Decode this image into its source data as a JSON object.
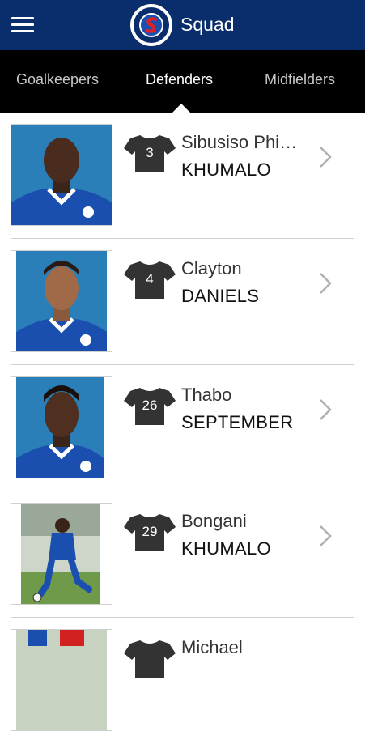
{
  "header": {
    "title": "Squad",
    "logo_alt": "SUPERSPORT UNITED FC"
  },
  "tabs": [
    {
      "label": "Goalkeepers",
      "active": false
    },
    {
      "label": "Defenders",
      "active": true
    },
    {
      "label": "Midfielders",
      "active": false
    }
  ],
  "players": [
    {
      "first": "Sibusiso Phi…",
      "last": "KHUMALO",
      "number": "3"
    },
    {
      "first": "Clayton",
      "last": "DANIELS",
      "number": "4"
    },
    {
      "first": "Thabo",
      "last": "SEPTEMBER",
      "number": "26"
    },
    {
      "first": "Bongani",
      "last": "KHUMALO",
      "number": "29"
    },
    {
      "first": "Michael",
      "last": "",
      "number": ""
    }
  ],
  "colors": {
    "header": "#0a2d6b",
    "tabs": "#000000",
    "shirt": "#333333",
    "kit_blue": "#1a4fb0"
  }
}
